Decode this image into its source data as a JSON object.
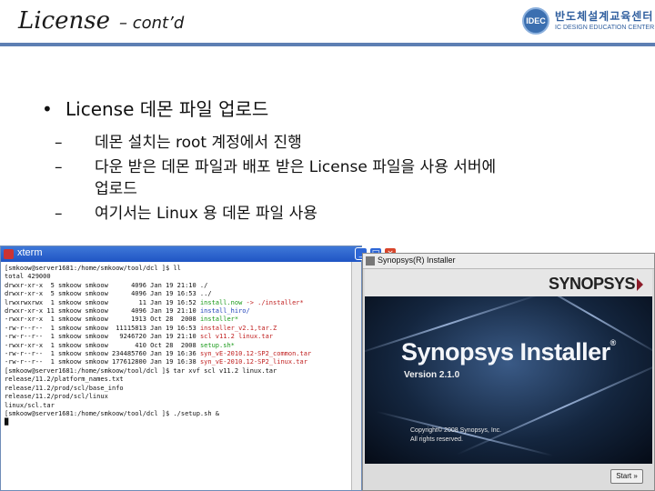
{
  "header": {
    "title": "License",
    "subtitle": "– cont’d",
    "logo_kr": "반도체설계교육센터",
    "logo_en": "IC DESIGN EDUCATION CENTER",
    "logo_mark": "IDEC"
  },
  "bullets": {
    "main": "License 데몬 파일 업로드",
    "dot": "•",
    "dash": "–",
    "sub": [
      "데몬 설치는 root 계정에서 진행",
      "다운 받은 데몬 파일과 배포 받은 License 파일을 사용 서버에",
      "업로드",
      "여기서는 Linux 용 데몬 파일 사용"
    ]
  },
  "xterm": {
    "title": "xterm",
    "lines": [
      {
        "t": "[smkoow@server1681:/home/smkoow/tool/dcl ]$ ll"
      },
      {
        "t": "total 429000"
      },
      {
        "t": "drwxr-xr-x  5 smkoow smkoow      4096 Jan 19 21:10 ./"
      },
      {
        "t": "drwxr-xr-x  5 smkoow smkoow      4096 Jan 19 16:53 ../"
      },
      {
        "t": "lrwxrwxrwx  1 smkoow smkoow        11 Jan 19 16:52 ",
        "g": "install.now",
        "r": " -> ./installer*"
      },
      {
        "t": "drwxr-xr-x 11 smkoow smkoow      4096 Jan 19 21:10 ",
        "b": "install_hiro/"
      },
      {
        "t": "-rwxr-xr-x  1 smkoow smkoow      1913 Oct 28  2008 ",
        "g": "installer*"
      },
      {
        "t": "-rw-r--r--  1 smkoow smkoow  11115813 Jan 19 16:53 ",
        "r": "installer_v2.1,tar.Z"
      },
      {
        "t": "-rw-r--r--  1 smkoow smkoow   9246720 Jan 19 21:10 ",
        "r": "scl v11.2 linux.tar"
      },
      {
        "t": "-rwxr-xr-x  1 smkoow smkoow       410 Oct 28  2008 ",
        "g": "setup.sh*"
      },
      {
        "t": "-rw-r--r--  1 smkoow smkoow 234485760 Jan 19 16:36 ",
        "r": "syn_vE-2010.12-SP2_common.tar"
      },
      {
        "t": "-rw-r--r--  1 smkoow smkoow 177612800 Jan 19 16:38 ",
        "r": "syn_vE-2010.12-SP2_linux.tar"
      },
      {
        "t": "[smkoow@server1681:/home/smkoow/tool/dcl ]$ tar xvf scl v11.2 linux.tar"
      },
      {
        "t": "release/11.2/platform_names.txt"
      },
      {
        "t": "release/11.2/prod/scl/base_info"
      },
      {
        "t": "release/11.2/prod/scl/linux"
      },
      {
        "t": "linux/scl.tar"
      },
      {
        "t": "[smkoow@server1681:/home/smkoow/tool/dcl ]$ ./setup.sh &"
      },
      {
        "t": "█"
      }
    ]
  },
  "installer": {
    "window_title": "Synopsys(R) Installer",
    "brand_logo": "SYNOPSYS",
    "product_title": "Synopsys Installer",
    "registered": "®",
    "version": "Version 2.1.0",
    "copyright_1": "Copyright© 2008 Synopsys, Inc.",
    "copyright_2": "All rights reserved.",
    "start_label": "Start »"
  },
  "window_buttons": {
    "minimize": "_",
    "maximize": "□",
    "close": "×"
  },
  "colors": {
    "header_line": "#5d7fb3",
    "xterm_titlebar": "#2a62cf",
    "terminal_green": "#1a9a1a",
    "terminal_red": "#c02020",
    "terminal_blue": "#2244bb",
    "splash_bg": "#14263f"
  }
}
